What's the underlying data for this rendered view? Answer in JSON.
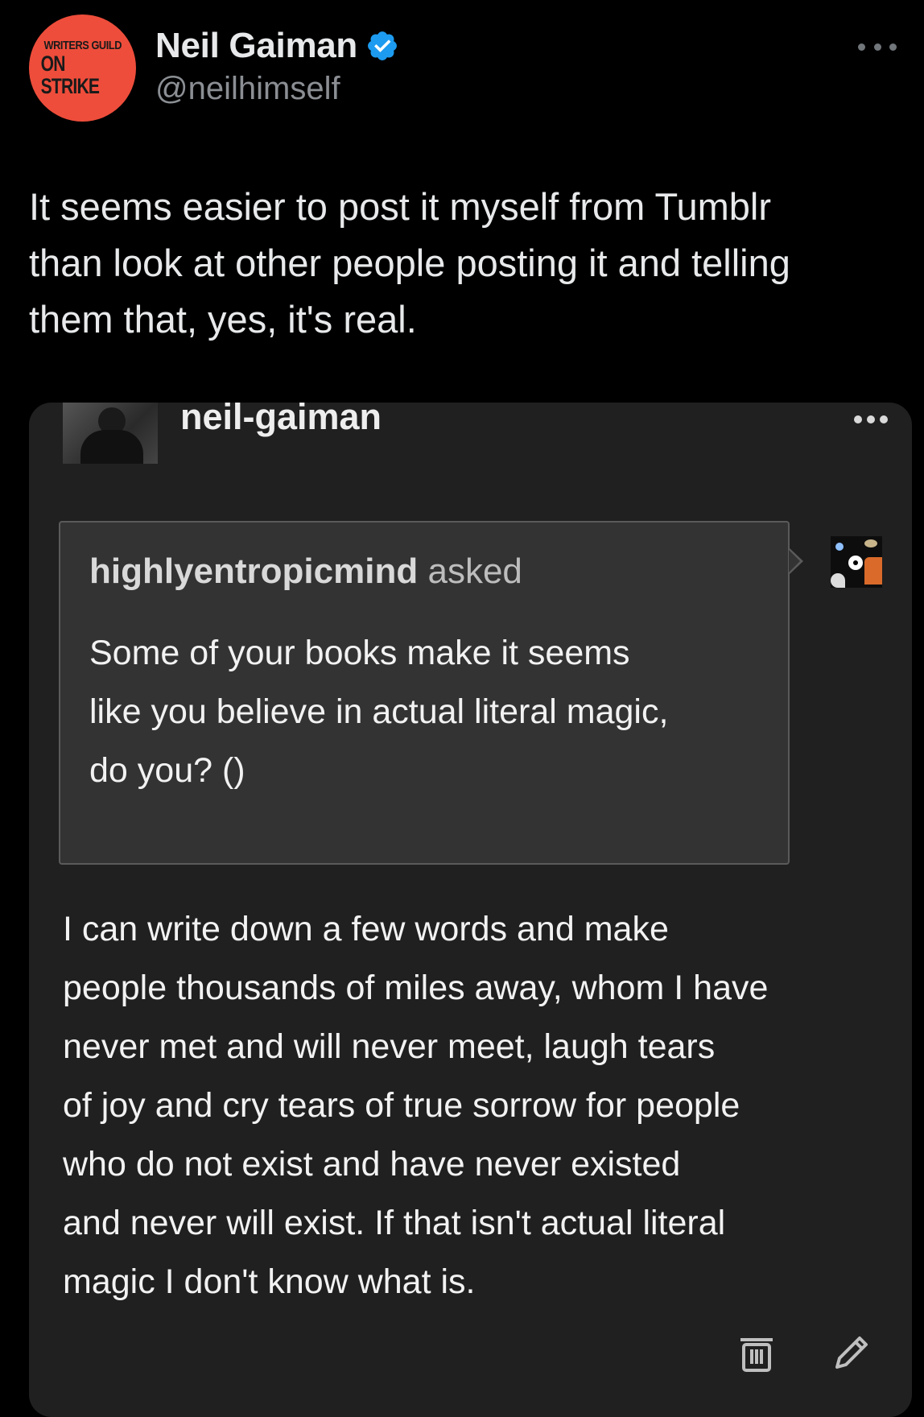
{
  "tweet": {
    "avatar_line1": "WRITERS GUILD",
    "avatar_line2": "ON STRIKE",
    "display_name": "Neil Gaiman",
    "handle": "@neilhimself",
    "text": "It seems easier to post it myself from Tumblr\nthan look at other people posting it and telling\nthem that, yes, it's real."
  },
  "tumblr_post": {
    "author": "neil-gaiman",
    "ask": {
      "asker": "highlyentropicmind",
      "verb": "asked",
      "question": "Some of your books make it seems\nlike you believe in actual literal magic,\ndo you? ()"
    },
    "answer": "I can write down a few words and make\npeople thousands of miles away, whom I have\nnever met and will never meet, laugh tears\nof joy and cry tears of true sorrow for people\nwho do not exist and have never existed\nand never will exist. If that isn't actual literal\nmagic I don't know what is."
  },
  "icons": {
    "verified": "verified-badge-icon",
    "more": "more-options-icon",
    "trash": "trash-icon",
    "edit": "pencil-icon"
  },
  "colors": {
    "background": "#000000",
    "card_background": "#202020",
    "ask_background": "#333333",
    "verified_blue": "#1d9bf0",
    "avatar_red": "#ee4d3b",
    "handle_gray": "#8b8f94"
  }
}
